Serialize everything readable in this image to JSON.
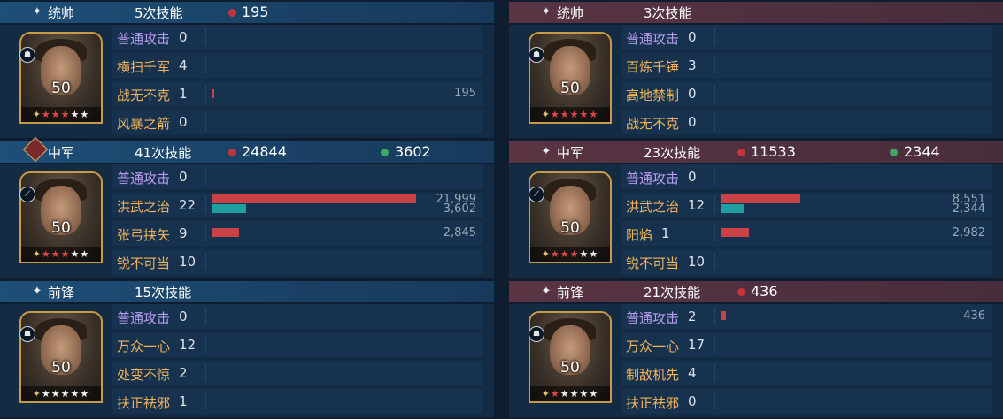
{
  "colors": {
    "left_header": "#1e4f78",
    "right_header": "#5a3442",
    "damage_bar": "#c84246",
    "heal_bar": "#1f9fa1",
    "tactic_skill_text": "#f0b35a",
    "normal_attack_text": "#b99cf0"
  },
  "teams": [
    {
      "side": "left",
      "sections": [
        {
          "position": "统帅",
          "position_icon": "sparkle-icon",
          "skill_count": "5次技能",
          "damage": "195",
          "heal": "",
          "hero": {
            "level": "50",
            "red_stars": 3,
            "white_stars": 2,
            "type_icon": "cavalry-icon"
          },
          "skills": [
            {
              "name": "普通攻击",
              "count": "0",
              "normal": true,
              "damage": null,
              "heal": null,
              "damage_label": ""
            },
            {
              "name": "横扫千军",
              "count": "4",
              "damage": null,
              "heal": null,
              "damage_label": ""
            },
            {
              "name": "战无不克",
              "count": "1",
              "damage": 195,
              "heal": null,
              "damage_label": "195"
            },
            {
              "name": "风暴之箭",
              "count": "0",
              "damage": null,
              "heal": null,
              "damage_label": ""
            }
          ]
        },
        {
          "position": "中军",
          "position_icon": "sword-badge-icon",
          "skill_count": "41次技能",
          "damage": "24844",
          "heal": "3602",
          "hero": {
            "level": "50",
            "red_stars": 3,
            "white_stars": 2,
            "type_icon": "spear-icon"
          },
          "skills": [
            {
              "name": "普通攻击",
              "count": "0",
              "normal": true,
              "damage": null,
              "heal": null,
              "damage_label": ""
            },
            {
              "name": "洪武之治",
              "count": "22",
              "damage": 21999,
              "heal": 3602,
              "damage_label": "21,999",
              "heal_label": "3,602"
            },
            {
              "name": "张弓挟矢",
              "count": "9",
              "damage": 2845,
              "heal": null,
              "damage_label": "2,845"
            },
            {
              "name": "锐不可当",
              "count": "10",
              "damage": null,
              "heal": null,
              "damage_label": ""
            }
          ]
        },
        {
          "position": "前锋",
          "position_icon": "sparkle-icon",
          "skill_count": "15次技能",
          "damage": "",
          "heal": "",
          "hero": {
            "level": "50",
            "red_stars": 0,
            "white_stars": 5,
            "type_icon": "cavalry-icon"
          },
          "skills": [
            {
              "name": "普通攻击",
              "count": "0",
              "normal": true,
              "damage": null,
              "heal": null,
              "damage_label": ""
            },
            {
              "name": "万众一心",
              "count": "12",
              "damage": null,
              "heal": null,
              "damage_label": ""
            },
            {
              "name": "处变不惊",
              "count": "2",
              "damage": null,
              "heal": null,
              "damage_label": ""
            },
            {
              "name": "扶正祛邪",
              "count": "1",
              "damage": null,
              "heal": null,
              "damage_label": ""
            }
          ]
        }
      ]
    },
    {
      "side": "right",
      "sections": [
        {
          "position": "统帅",
          "position_icon": "sparkle-icon",
          "skill_count": "3次技能",
          "damage": "",
          "heal": "",
          "hero": {
            "level": "50",
            "red_stars": 5,
            "white_stars": 0,
            "type_icon": "cavalry-icon"
          },
          "skills": [
            {
              "name": "普通攻击",
              "count": "0",
              "normal": true,
              "damage": null,
              "heal": null,
              "damage_label": ""
            },
            {
              "name": "百炼千锤",
              "count": "3",
              "damage": null,
              "heal": null,
              "damage_label": ""
            },
            {
              "name": "高地禁制",
              "count": "0",
              "damage": null,
              "heal": null,
              "damage_label": ""
            },
            {
              "name": "战无不克",
              "count": "0",
              "damage": null,
              "heal": null,
              "damage_label": ""
            }
          ]
        },
        {
          "position": "中军",
          "position_icon": "sparkle-icon",
          "skill_count": "23次技能",
          "damage": "11533",
          "heal": "2344",
          "hero": {
            "level": "50",
            "red_stars": 3,
            "white_stars": 2,
            "type_icon": "spear-icon"
          },
          "skills": [
            {
              "name": "普通攻击",
              "count": "0",
              "normal": true,
              "damage": null,
              "heal": null,
              "damage_label": ""
            },
            {
              "name": "洪武之治",
              "count": "12",
              "damage": 8551,
              "heal": 2344,
              "damage_label": "8,551",
              "heal_label": "2,344"
            },
            {
              "name": "阳焰",
              "count": "1",
              "damage": 2982,
              "heal": null,
              "damage_label": "2,982"
            },
            {
              "name": "锐不可当",
              "count": "10",
              "damage": null,
              "heal": null,
              "damage_label": ""
            }
          ]
        },
        {
          "position": "前锋",
          "position_icon": "sparkle-icon",
          "skill_count": "21次技能",
          "damage": "436",
          "heal": "",
          "hero": {
            "level": "50",
            "red_stars": 1,
            "white_stars": 4,
            "type_icon": "cavalry-icon"
          },
          "skills": [
            {
              "name": "普通攻击",
              "count": "2",
              "normal": true,
              "damage": 436,
              "heal": null,
              "damage_label": "436"
            },
            {
              "name": "万众一心",
              "count": "17",
              "damage": null,
              "heal": null,
              "damage_label": ""
            },
            {
              "name": "制敌机先",
              "count": "4",
              "damage": null,
              "heal": null,
              "damage_label": ""
            },
            {
              "name": "扶正祛邪",
              "count": "0",
              "damage": null,
              "heal": null,
              "damage_label": ""
            }
          ]
        }
      ]
    }
  ]
}
